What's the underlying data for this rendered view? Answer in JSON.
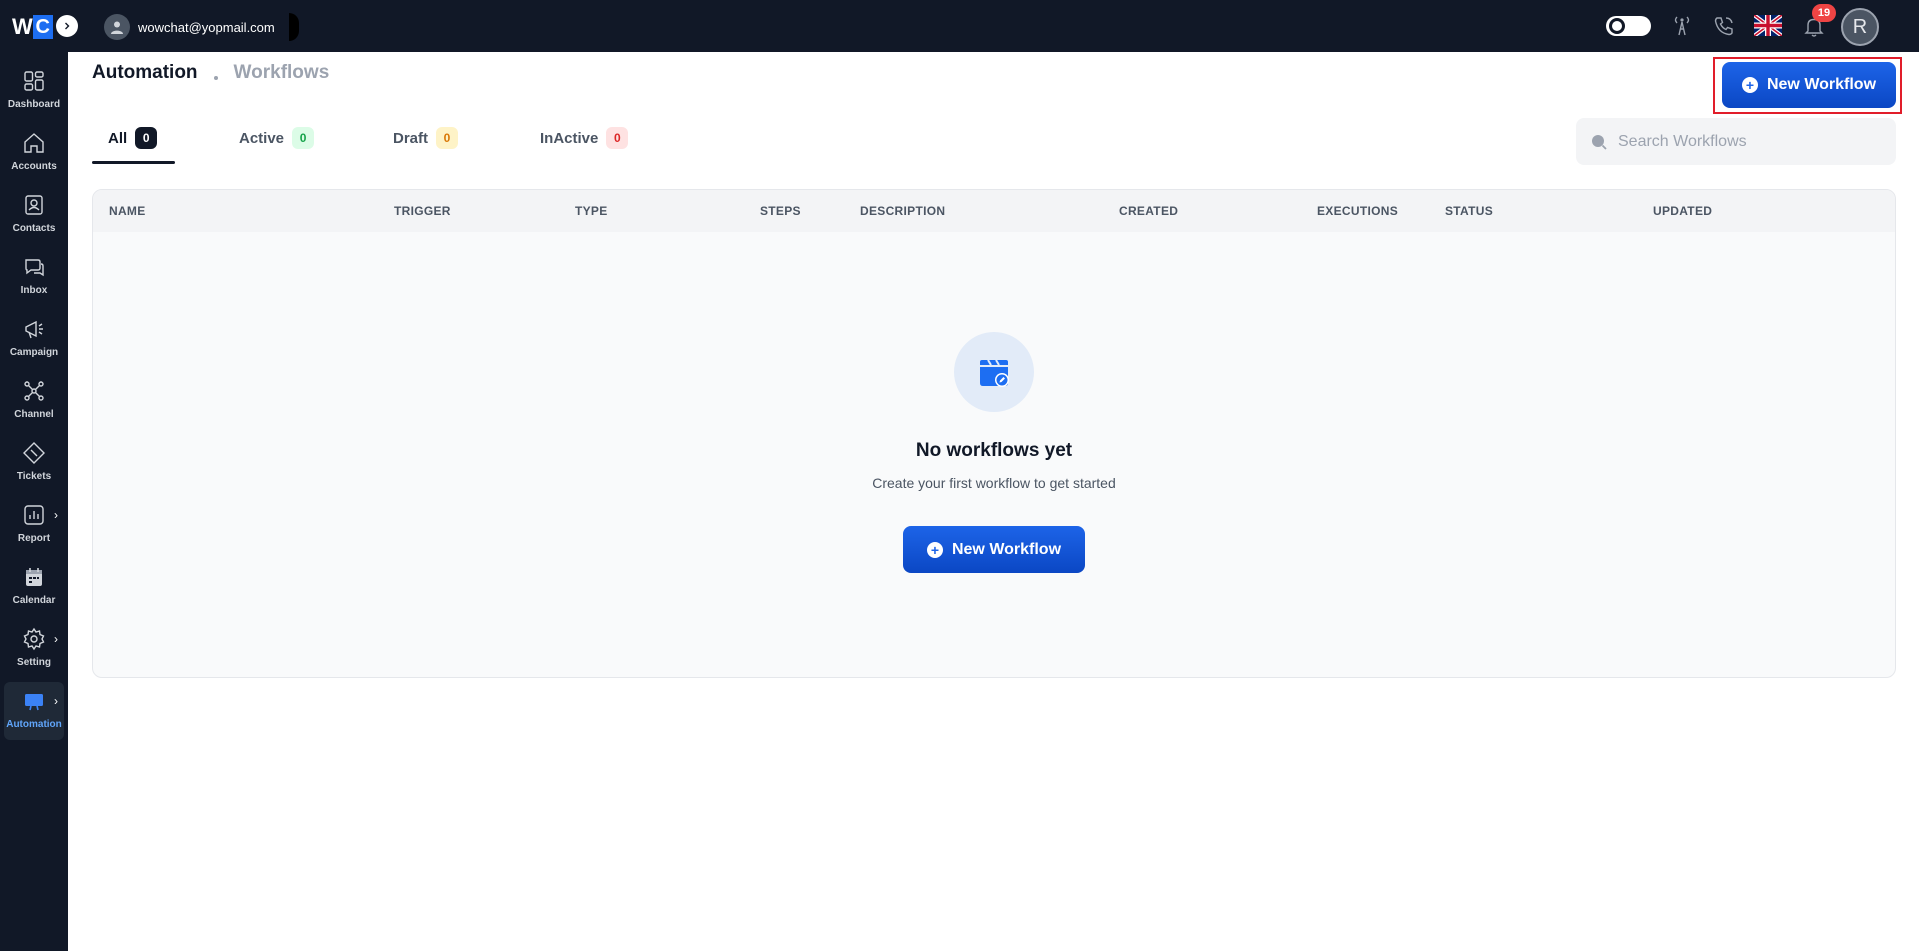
{
  "topbar": {
    "logo_w": "W",
    "logo_c": "C",
    "user_email": "wowchat@yopmail.com",
    "notification_count": "19",
    "profile_initial": "R"
  },
  "sidebar": {
    "items": [
      {
        "label": "Dashboard",
        "icon": "dashboard-icon"
      },
      {
        "label": "Accounts",
        "icon": "home-icon"
      },
      {
        "label": "Contacts",
        "icon": "contacts-icon"
      },
      {
        "label": "Inbox",
        "icon": "chat-icon"
      },
      {
        "label": "Campaign",
        "icon": "megaphone-icon"
      },
      {
        "label": "Channel",
        "icon": "network-icon"
      },
      {
        "label": "Tickets",
        "icon": "ticket-icon"
      },
      {
        "label": "Report",
        "icon": "report-icon"
      },
      {
        "label": "Calendar",
        "icon": "calendar-icon"
      },
      {
        "label": "Setting",
        "icon": "gear-icon"
      },
      {
        "label": "Automation",
        "icon": "automation-icon"
      }
    ],
    "active": "Automation"
  },
  "breadcrumb": {
    "main": "Automation",
    "sub": "Workflows"
  },
  "header": {
    "new_workflow_label": "New Workflow"
  },
  "tabs": [
    {
      "label": "All",
      "count": "0",
      "badge_bg": "#111827",
      "badge_fg": "#ffffff"
    },
    {
      "label": "Active",
      "count": "0",
      "badge_bg": "#dcfce7",
      "badge_fg": "#16a34a"
    },
    {
      "label": "Draft",
      "count": "0",
      "badge_bg": "#fef3c7",
      "badge_fg": "#d97706"
    },
    {
      "label": "InActive",
      "count": "0",
      "badge_bg": "#fee2e2",
      "badge_fg": "#dc2626"
    }
  ],
  "search": {
    "placeholder": "Search Workflows"
  },
  "table": {
    "columns": [
      "NAME",
      "TRIGGER",
      "TYPE",
      "STEPS",
      "DESCRIPTION",
      "CREATED",
      "EXECUTIONS",
      "STATUS",
      "UPDATED"
    ]
  },
  "empty_state": {
    "title": "No workflows yet",
    "subtitle": "Create your first workflow to get started",
    "button_label": "New Workflow"
  },
  "colors": {
    "topbar_bg": "#111827",
    "primary": "#1d64e8",
    "highlight_frame": "#e11d2a"
  }
}
